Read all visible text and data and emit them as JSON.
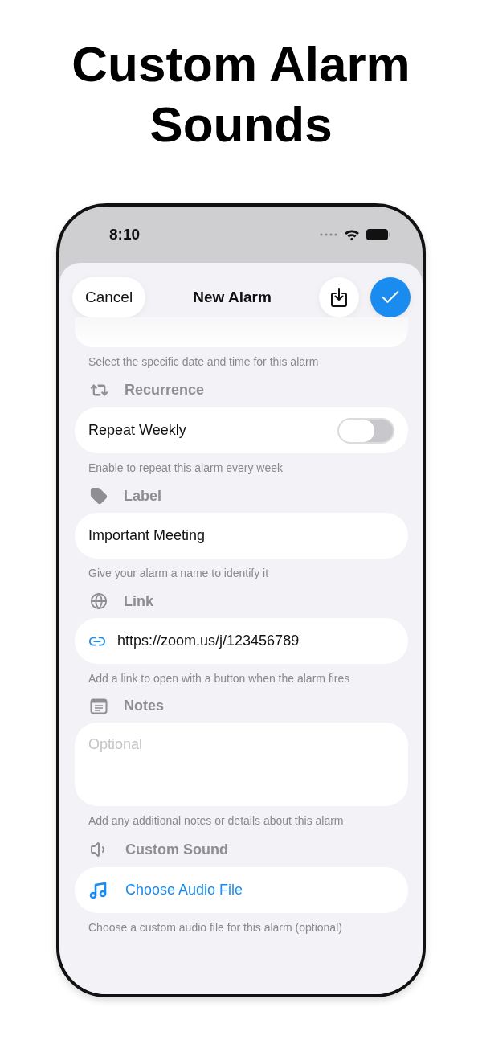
{
  "headline": "Custom Alarm Sounds",
  "status_bar": {
    "time": "8:10"
  },
  "nav": {
    "cancel": "Cancel",
    "title": "New Alarm"
  },
  "date_hint": "Select the specific date and time for this alarm",
  "sections": [
    {
      "kind": "toggle",
      "header": "Recurrence",
      "label": "Repeat Weekly",
      "on": false,
      "hint": "Enable to repeat this alarm every week"
    },
    {
      "kind": "text",
      "header": "Label",
      "value": "Important Meeting",
      "hint": "Give your alarm a name to identify it"
    },
    {
      "kind": "link",
      "header": "Link",
      "value": "https://zoom.us/j/123456789",
      "hint": "Add a link to open with a button when the alarm fires"
    },
    {
      "kind": "notes",
      "header": "Notes",
      "placeholder": "Optional",
      "hint": "Add any additional notes or details about this alarm"
    },
    {
      "kind": "audio",
      "header": "Custom Sound",
      "label": "Choose Audio File",
      "hint": "Choose a custom audio file for this alarm (optional)"
    }
  ]
}
